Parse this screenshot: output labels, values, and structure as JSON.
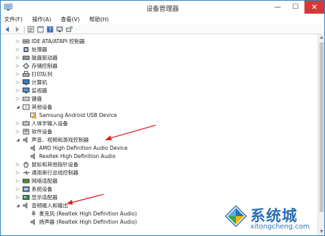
{
  "window": {
    "title": "设备管理器",
    "controls": {
      "minimize": "—",
      "maximize": "☐",
      "close": "✕"
    }
  },
  "menu": [
    {
      "label": "文件(F)"
    },
    {
      "label": "操作(A)"
    },
    {
      "label": "查看(V)"
    },
    {
      "label": "帮助(H)"
    }
  ],
  "toolbar": {
    "buttons": [
      "back-icon",
      "forward-icon",
      "properties-icon",
      "window-icon",
      "help-icon",
      "monitor-icon",
      "scan-icon"
    ]
  },
  "tree": {
    "items": [
      {
        "label": "IDE ATA/ATAPI 控制器",
        "expanded": false
      },
      {
        "label": "处理器",
        "expanded": false
      },
      {
        "label": "磁盘驱动器",
        "expanded": false
      },
      {
        "label": "存储控制器",
        "expanded": false
      },
      {
        "label": "打印队列",
        "expanded": false
      },
      {
        "label": "计算机",
        "expanded": false
      },
      {
        "label": "监视器",
        "expanded": false
      },
      {
        "label": "键盘",
        "expanded": false
      },
      {
        "label": "其他设备",
        "expanded": true
      },
      {
        "label": "Samsung Android USB Device",
        "child": true
      },
      {
        "label": "人体学输入设备",
        "expanded": false
      },
      {
        "label": "软件设备",
        "expanded": false
      },
      {
        "label": "声音、视频和游戏控制器",
        "expanded": true
      },
      {
        "label": "AMD High Definition Audio Device",
        "child": true
      },
      {
        "label": "Realtek High Definition Audio",
        "child": true
      },
      {
        "label": "鼠标和其他指针设备",
        "expanded": false
      },
      {
        "label": "通用串行总线控制器",
        "expanded": false
      },
      {
        "label": "网络适配器",
        "expanded": false
      },
      {
        "label": "系统设备",
        "expanded": false
      },
      {
        "label": "显示适配器",
        "expanded": false
      },
      {
        "label": "音频输入和输出",
        "expanded": true
      },
      {
        "label": "麦克风 (Realtek High Definition Audio)",
        "child": true
      },
      {
        "label": "扬声器 (Realtek High Definition Audio)",
        "child": true
      }
    ]
  },
  "watermark": {
    "text": "系统城",
    "url": "xitongcheng.com"
  },
  "colors": {
    "accent": "#2f7bbf",
    "annotation": "#e02020",
    "close_button": "#d23a3a"
  }
}
